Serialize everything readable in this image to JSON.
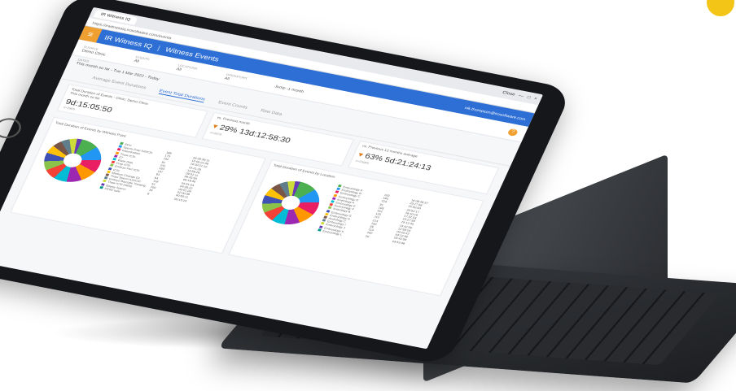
{
  "browser": {
    "tab_title": "IR Witness IQ",
    "url": "https://irwitnessiq.irosoftware.com/events",
    "window_controls": [
      "Close",
      "—",
      "□",
      "×"
    ]
  },
  "app": {
    "brand": "IR Witness IQ",
    "page_title": "Witness Events",
    "user_email": "nik.thompson@irosoftware.com",
    "accent_color": "#2e6fd6",
    "menu_color": "#f0a030"
  },
  "filters": {
    "source_label": "SOURCE",
    "source_value": "Demo Clinic",
    "events_label": "EVENTS",
    "events_value": "All",
    "locations_label": "LOCATIONS",
    "locations_value": "All",
    "operators_label": "OPERATORS",
    "operators_value": "All",
    "jump_label": "Jump -1 month",
    "help_icon": "question-icon"
  },
  "dates": {
    "label": "DATES",
    "value": "This month so far - Tue 1 Mar 2022 - Today"
  },
  "tabs": [
    {
      "label": "Average Event Durations"
    },
    {
      "label": "Event Total Durations"
    },
    {
      "label": "Event Counts"
    },
    {
      "label": "Raw Data"
    }
  ],
  "kpis": {
    "title": "Total Duration of Events - Clinic: Demo Clinic",
    "current_label": "This month so far",
    "current_value": "9d:15:05:50",
    "current_count": "n=2985",
    "prev_label": "vs. Previous month",
    "prev_change": "29%",
    "prev_value": "13d:12:58:30",
    "prev_count": "n=3978",
    "prev12_label": "vs. Previous 12 months average",
    "prev12_change": "63%",
    "prev12_value": "5d:21:24:13",
    "prev12_count": "n=23965"
  },
  "panels": {
    "left_title": "Total Duration of Events by Witness Point",
    "right_title": "Total Duration of Events by Location",
    "col_count": "COUNT",
    "col_total": "TOTAL TIME"
  },
  "left_legend": [
    "EPU",
    "Sperm Prep IUI/ICSI",
    "Insemination",
    "Thaw ICSI",
    "ET",
    "Wash Dish",
    "Prep ICSI",
    "Embryo Fert ICSI",
    "ICSI",
    "Medium Change D1",
    "Thaw Sperm IUI/ICSI",
    "Embryo Barcode Thawing",
    "Thaw ICSI (IMSI)",
    "Biopsy Sperm",
    "PESE tube"
  ],
  "right_legend": [
    "Embryology A",
    "Embryology B",
    "Embryology C",
    "Embryology D",
    "Andrology A",
    "Embryology E",
    "Embryology F",
    "Andrology B",
    "Embryology G",
    "Embryology H",
    "Andrology C",
    "Embryology I",
    "Embryology J",
    "Embryology K",
    "Embryology L"
  ],
  "left_counts": [
    "188",
    "175",
    "152",
    "91",
    "241",
    "193",
    "137",
    "81",
    "64",
    "118",
    "51",
    "100",
    "34",
    "8"
  ],
  "left_totals": [
    "2d 05:49:11",
    "1d 05:21:36",
    "1d 00:21:12",
    "15:41:29",
    "14:59:28",
    "09:51:11",
    "08:43:30",
    "06:19:35",
    "04:51:04",
    "04:30:22",
    "03:51:28",
    "02:00:38",
    "00:53:11",
    "00:15:24"
  ],
  "right_counts": [
    "153",
    "190",
    "223",
    "91",
    "103",
    "152",
    "125",
    "112",
    "214",
    "100",
    "39",
    "113",
    "182",
    "20"
  ],
  "right_totals": [
    "1d 09:48:37",
    "23:17:58",
    "22:50:50",
    "20:52:17",
    "18:10:16",
    "17:51:53",
    "15:27:59",
    "15:12:40",
    "13:42:59",
    "12:59:24",
    "04:25:42",
    "03:12:58",
    "03:42:58",
    "03:52:08"
  ],
  "colors": [
    "#4caf50",
    "#2196f3",
    "#e91e63",
    "#ff9800",
    "#9c27b0",
    "#00bcd4",
    "#f44336",
    "#8bc34a",
    "#3f51b5",
    "#ffc107",
    "#795548",
    "#607d8b",
    "#cddc39",
    "#673ab7",
    "#009688"
  ]
}
